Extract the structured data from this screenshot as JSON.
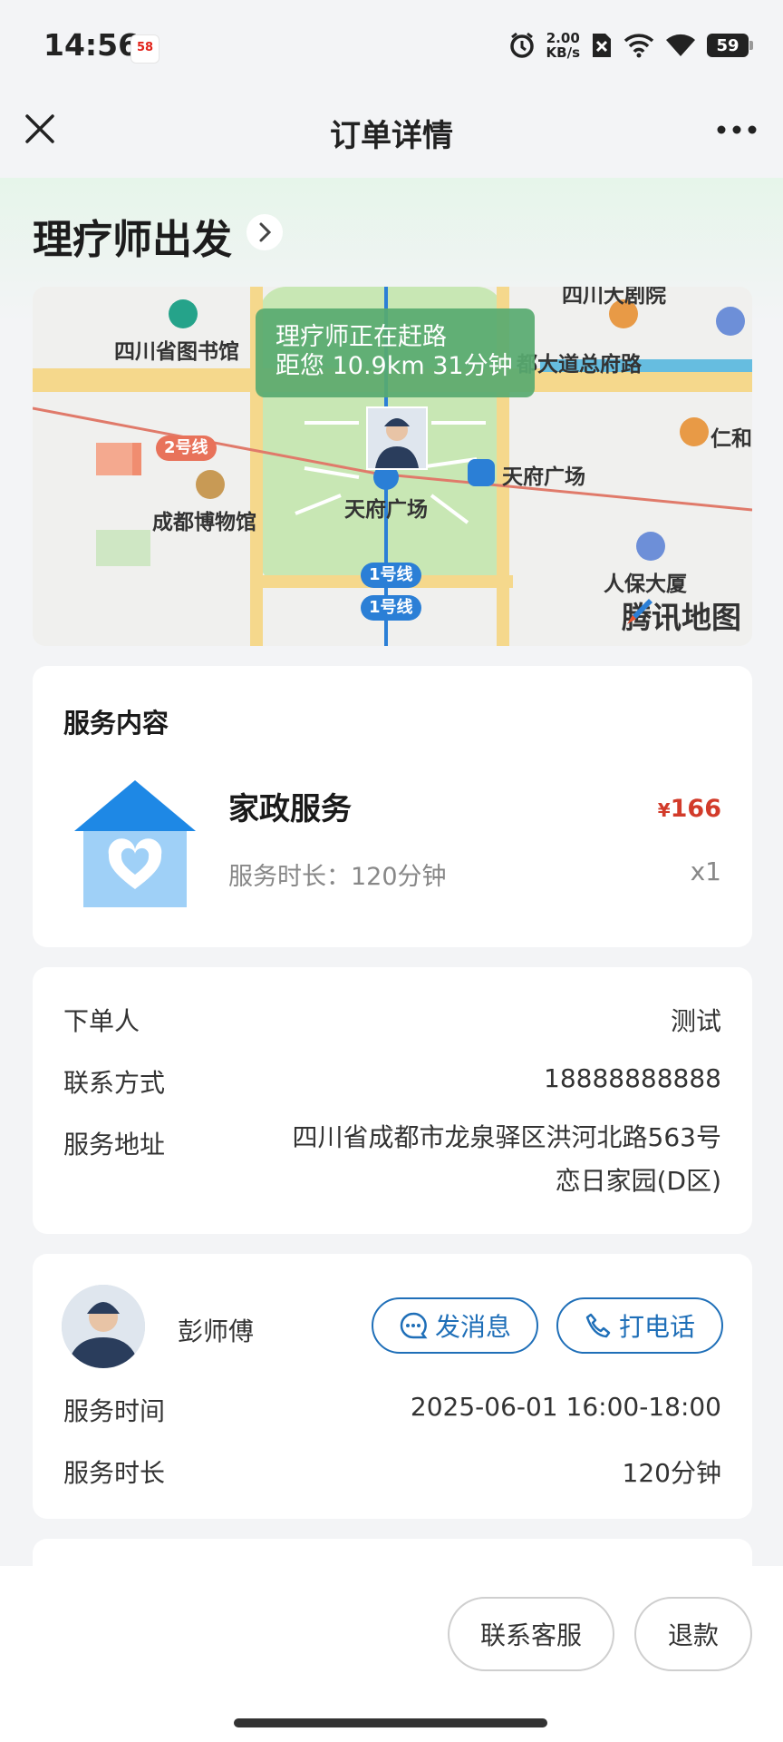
{
  "status_bar": {
    "time": "14:56",
    "app_badge": "58",
    "network_speed_value": "2.00",
    "network_speed_unit": "KB/s",
    "battery": "59"
  },
  "header": {
    "title": "订单详情"
  },
  "order_status": {
    "title": "理疗师出发"
  },
  "map": {
    "tooltip_line1": "理疗师正在赶路",
    "tooltip_line2": "距您 10.9km 31分钟",
    "labels": {
      "library": "四川省图书馆",
      "road": "都大道总府路",
      "ren": "仁和",
      "museum": "成都博物馆",
      "square_center": "天府广场",
      "square_station": "天府广场",
      "renbao": "人保大厦",
      "theater": "四川大剧院"
    },
    "line_badges": {
      "line2": "2号线",
      "line1a": "1号线",
      "line1b": "1号线"
    },
    "provider": "腾讯地图"
  },
  "service": {
    "section_title": "服务内容",
    "name": "家政服务",
    "duration_text": "服务时长：120分钟",
    "price_symbol": "¥",
    "price": "166",
    "quantity": "x1"
  },
  "order_info": {
    "rows": [
      {
        "label": "下单人",
        "value": "测试"
      },
      {
        "label": "联系方式",
        "value": "18888888888"
      },
      {
        "label": "服务地址",
        "value_line1": "四川省成都市龙泉驿区洪河北路563号",
        "value_line2": "恋日家园(D区)"
      }
    ]
  },
  "worker": {
    "name": "彭师傅",
    "message_label": "发消息",
    "call_label": "打电话",
    "rows": [
      {
        "label": "服务时间",
        "value": "2025-06-01 16:00-18:00"
      },
      {
        "label": "服务时长",
        "value": "120分钟"
      }
    ]
  },
  "bottom": {
    "service_label": "联系客服",
    "refund_label": "退款"
  },
  "colors": {
    "accent_blue": "#1f6fb8",
    "price_red": "#d23b2a",
    "map_green": "#58aa70",
    "house_blue": "#1e88e5"
  }
}
